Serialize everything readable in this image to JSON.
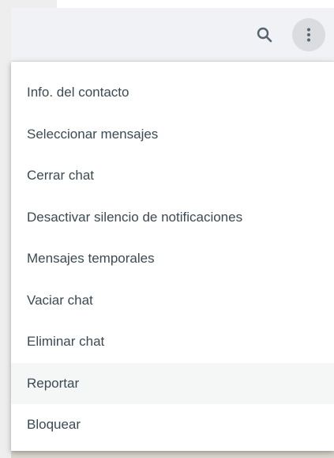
{
  "header": {
    "search_icon": "search-icon",
    "menu_icon": "kebab-menu-icon"
  },
  "menu": {
    "items": [
      {
        "label": "Info. del contacto"
      },
      {
        "label": "Seleccionar mensajes"
      },
      {
        "label": "Cerrar chat"
      },
      {
        "label": "Desactivar silencio de notificaciones"
      },
      {
        "label": "Mensajes temporales"
      },
      {
        "label": "Vaciar chat"
      },
      {
        "label": "Eliminar chat"
      },
      {
        "label": "Reportar"
      },
      {
        "label": "Bloquear"
      }
    ],
    "hovered_item": "Reportar"
  },
  "colors": {
    "text": "#3b4a54",
    "icon": "#54656f",
    "header_bg": "#f0f2f5",
    "hover_bg": "#f5f6f6",
    "menu_button_active_bg": "#dadcdf"
  }
}
